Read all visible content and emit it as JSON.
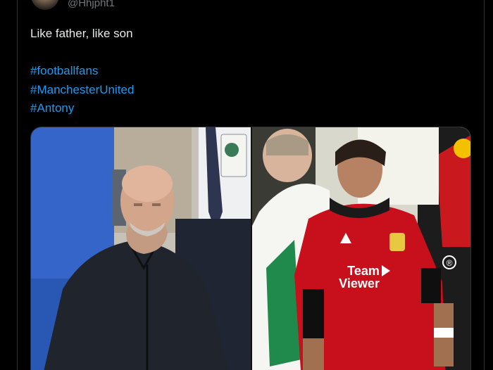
{
  "tweet": {
    "handle": "@Hhjpht1",
    "text_line1": "Like father, like son",
    "hashtags": [
      "#footballfans",
      "#ManchesterUnited",
      "#Antony"
    ]
  },
  "media": {
    "left_photo_icon": "man-in-black-jacket-photo-icon",
    "right_photo_icon": "player-in-red-kit-photo-icon",
    "jersey_text_line1": "Team",
    "jersey_text_line2": "Viewer",
    "board_mark": "®"
  },
  "colors": {
    "background": "#000000",
    "text": "#e7e9ea",
    "muted": "#71767b",
    "link": "#1d9bf0",
    "border": "#2f3336"
  }
}
